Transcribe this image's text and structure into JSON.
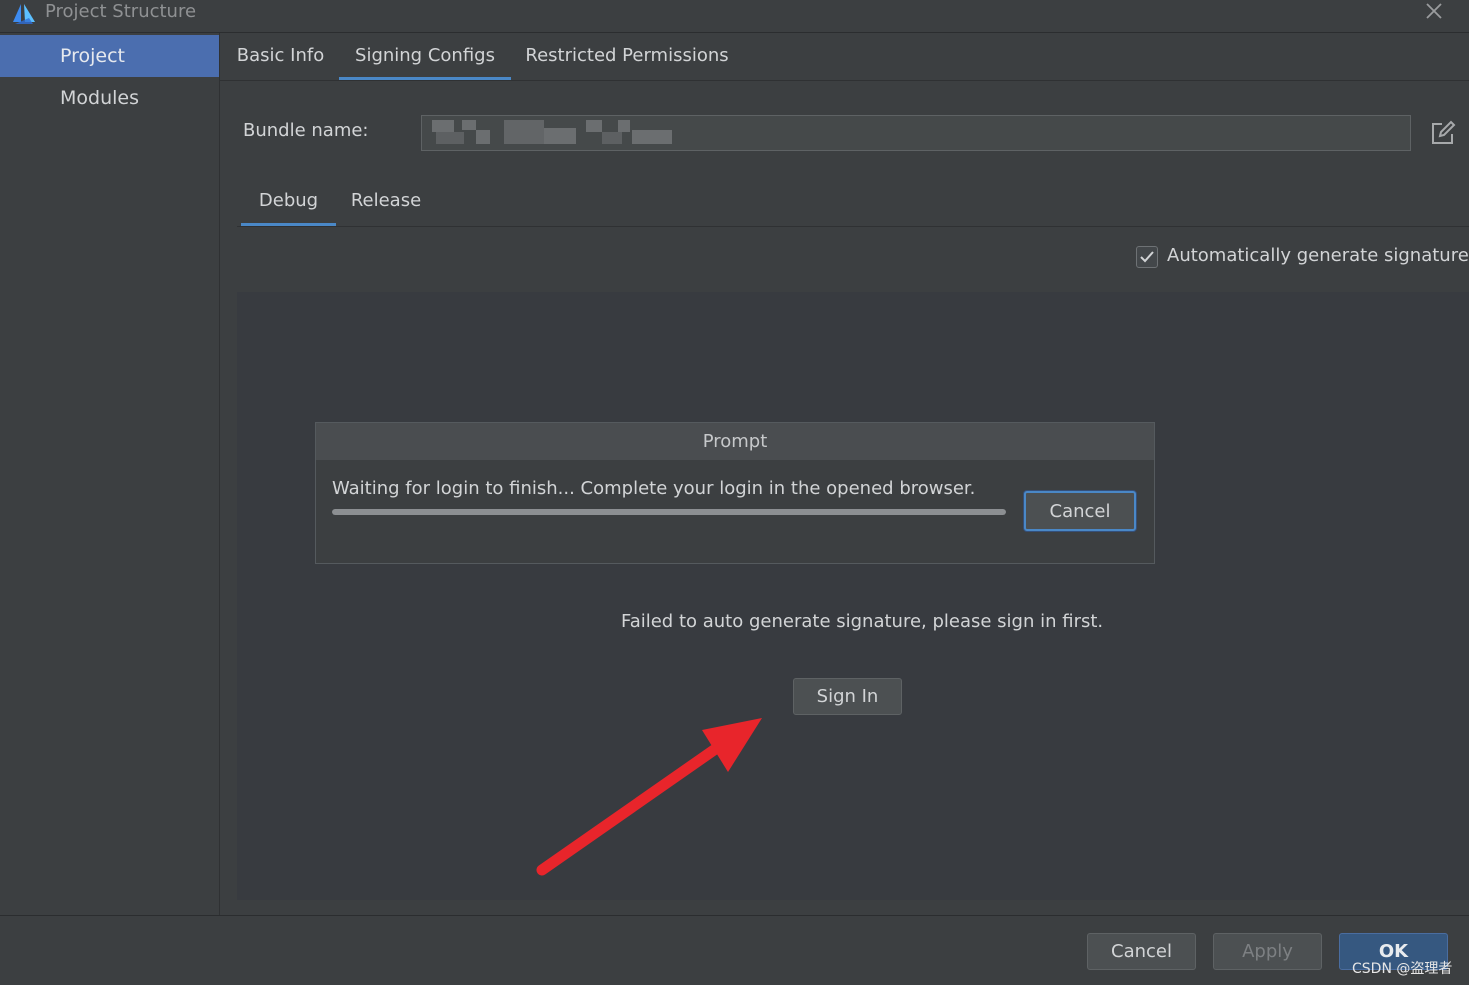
{
  "window": {
    "title": "Project Structure"
  },
  "sidebar": {
    "items": [
      {
        "label": "Project",
        "active": true
      },
      {
        "label": "Modules",
        "active": false
      }
    ]
  },
  "tabs": [
    {
      "label": "Basic Info",
      "active": false
    },
    {
      "label": "Signing Configs",
      "active": true
    },
    {
      "label": "Restricted Permissions",
      "active": false
    }
  ],
  "bundle": {
    "label": "Bundle name:"
  },
  "subtabs": [
    {
      "label": "Debug",
      "active": true
    },
    {
      "label": "Release",
      "active": false
    }
  ],
  "auto_sign": {
    "label": "Automatically generate signature",
    "checked": true
  },
  "prompt": {
    "title": "Prompt",
    "message": "Waiting for login to finish... Complete your login in the opened browser.",
    "progress": 1.0,
    "cancel_label": "Cancel"
  },
  "status": {
    "message": "Failed to auto generate signature, please sign in first."
  },
  "signin": {
    "label": "Sign In"
  },
  "footer": {
    "cancel_label": "Cancel",
    "apply_label": "Apply",
    "ok_label": "OK"
  },
  "watermark": "CSDN @盗理者",
  "colors": {
    "accent": "#4a88c7",
    "selection": "#4b6eaf",
    "annotation_arrow": "#e8252b"
  }
}
